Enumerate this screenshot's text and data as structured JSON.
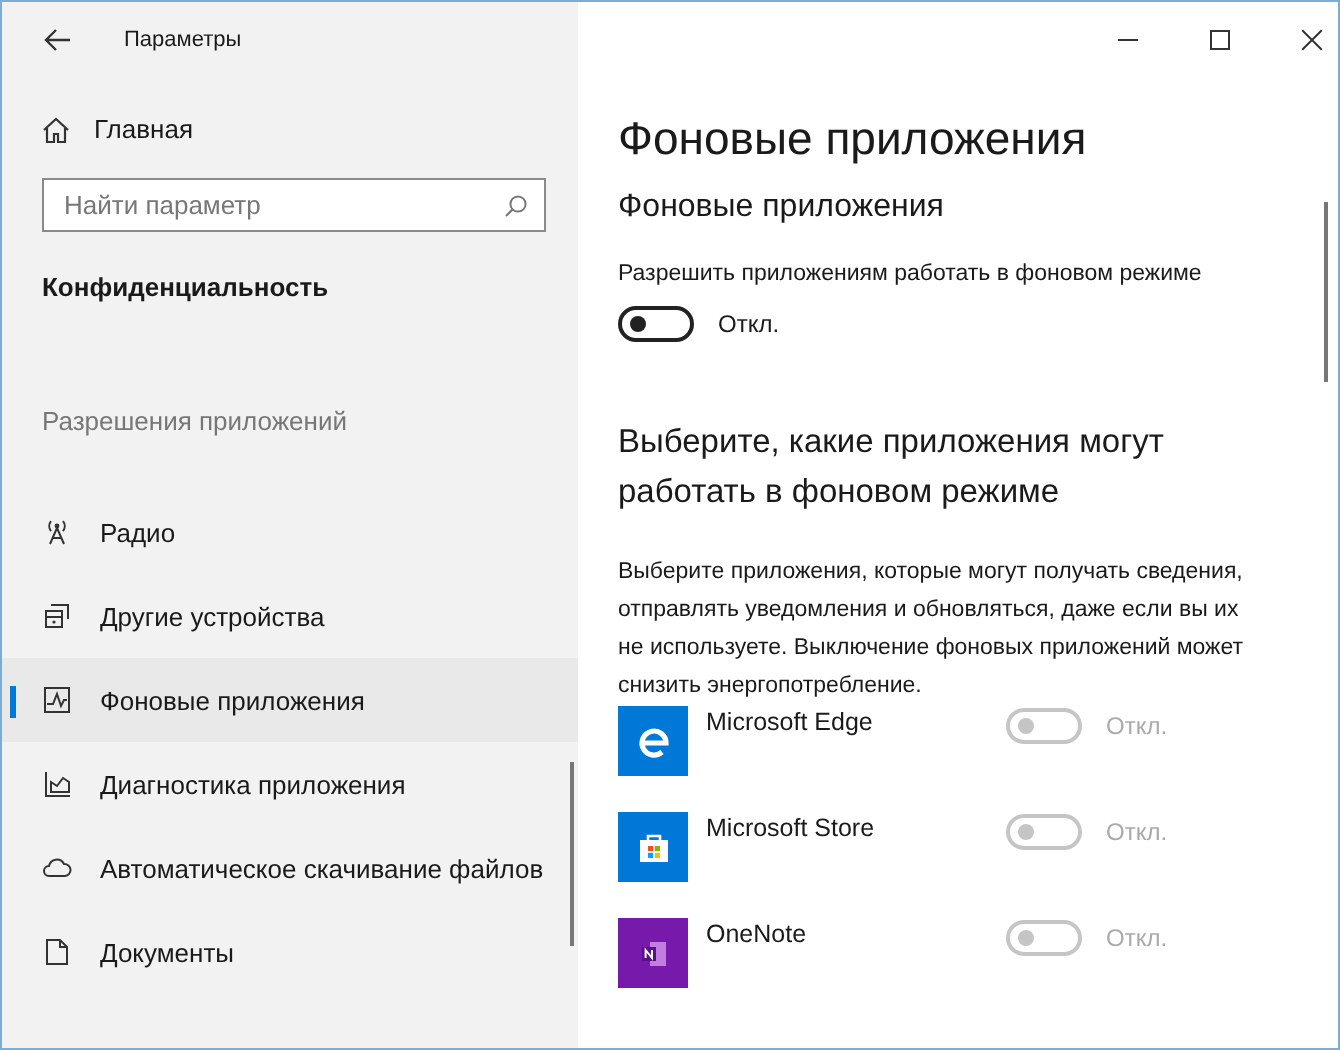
{
  "window": {
    "title": "Параметры"
  },
  "sidebar": {
    "home": "Главная",
    "search": {
      "placeholder": "Найти параметр"
    },
    "section": "Конфиденциальность",
    "group": "Разрешения приложений",
    "items": [
      {
        "label": "Радио",
        "selected": false
      },
      {
        "label": "Другие устройства",
        "selected": false
      },
      {
        "label": "Фоновые приложения",
        "selected": true
      },
      {
        "label": "Диагностика приложения",
        "selected": false
      },
      {
        "label": "Автоматическое скачивание файлов",
        "selected": false
      },
      {
        "label": "Документы",
        "selected": false
      }
    ]
  },
  "page": {
    "title": "Фоновые приложения",
    "subtitle": "Фоновые приложения",
    "allow_label": "Разрешить приложениям работать в фоновом режиме",
    "allow_toggle": {
      "on": false,
      "disabled": false,
      "status": "Откл."
    },
    "choose_heading": "Выберите, какие приложения могут работать в фоновом режиме",
    "choose_description": "Выберите приложения, которые могут получать сведения, отправлять уведомления и обновляться, даже если вы их не используете. Выключение фоновых приложений может снизить энергопотребление.",
    "apps": [
      {
        "name": "Microsoft Edge",
        "color": "#0078d7",
        "on": false,
        "disabled": true,
        "status": "Откл."
      },
      {
        "name": "Microsoft Store",
        "color": "#0078d7",
        "on": false,
        "disabled": true,
        "status": "Откл."
      },
      {
        "name": "OneNote",
        "color": "#7719aa",
        "on": false,
        "disabled": true,
        "status": "Откл."
      }
    ]
  }
}
